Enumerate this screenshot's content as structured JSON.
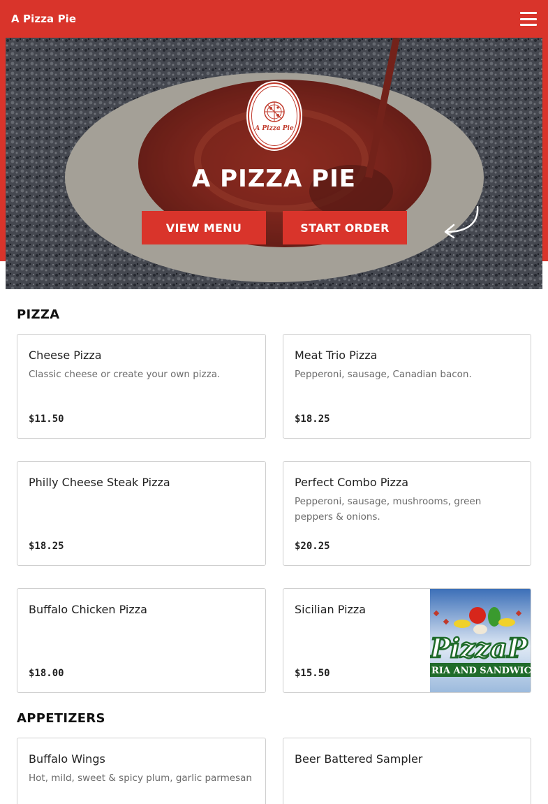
{
  "header": {
    "brand": "A Pizza Pie",
    "menu_icon": "hamburger-menu-icon"
  },
  "hero": {
    "logo_text": "A Pizza Pie",
    "title": "A PIZZA PIE",
    "view_menu_label": "VIEW MENU",
    "start_order_label": "START ORDER"
  },
  "sections": [
    {
      "title": "PIZZA",
      "items": [
        {
          "name": "Cheese Pizza",
          "description": "Classic cheese or create your own pizza.",
          "price": "$11.50"
        },
        {
          "name": "Meat Trio Pizza",
          "description": "Pepperoni, sausage, Canadian bacon.",
          "price": "$18.25"
        },
        {
          "name": "Philly Cheese Steak Pizza",
          "description": "",
          "price": "$18.25"
        },
        {
          "name": "Perfect Combo Pizza",
          "description": "Pepperoni, sausage, mushrooms, green peppers & onions.",
          "price": "$20.25"
        },
        {
          "name": "Buffalo Chicken Pizza",
          "description": "",
          "price": "$18.00"
        },
        {
          "name": "Sicilian Pizza",
          "description": "",
          "price": "$15.50",
          "image_text": "PizzaP",
          "image_subtext": "RIA AND SANDWICH"
        }
      ]
    },
    {
      "title": "APPETIZERS",
      "items": [
        {
          "name": "Buffalo Wings",
          "description": "Hot, mild, sweet & spicy plum, garlic parmesan",
          "price": ""
        },
        {
          "name": "Beer Battered Sampler",
          "description": "",
          "price": ""
        }
      ]
    }
  ],
  "colors": {
    "brand_red": "#d9342b",
    "card_border": "#cfcfcf"
  }
}
